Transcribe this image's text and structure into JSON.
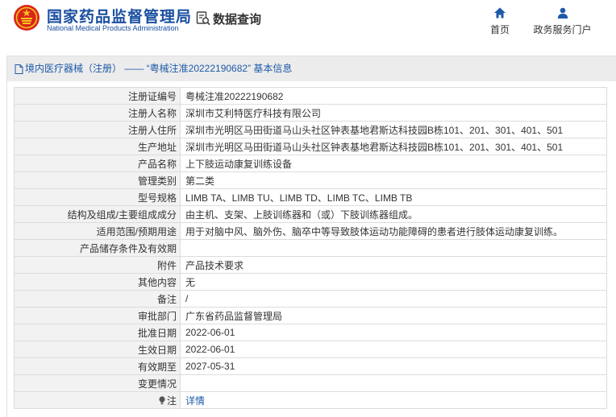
{
  "header": {
    "site_name_cn": "国家药品监督管理局",
    "site_name_en": "National Medical Products Administration",
    "data_query_label": "数据查询",
    "nav": [
      {
        "label": "首页",
        "icon": "home-icon"
      },
      {
        "label": "政务服务门户",
        "icon": "user-icon"
      }
    ]
  },
  "colors": {
    "brand": "#1a4fa0",
    "link": "#1d5aa8",
    "label_bg": "#f2f2f2",
    "title_bg": "#ececec"
  },
  "panel": {
    "title": "境内医疗器械（注册） —— “粤械注准20222190682” 基本信息"
  },
  "rows": [
    {
      "label": "注册证编号",
      "value": "粤械注准20222190682"
    },
    {
      "label": "注册人名称",
      "value": "深圳市艾利特医疗科技有限公司"
    },
    {
      "label": "注册人住所",
      "value": "深圳市光明区马田街道马山头社区钟表基地君斯达科技园B栋101、201、301、401、501"
    },
    {
      "label": "生产地址",
      "value": "深圳市光明区马田街道马山头社区钟表基地君斯达科技园B栋101、201、301、401、501"
    },
    {
      "label": "产品名称",
      "value": "上下肢运动康复训练设备"
    },
    {
      "label": "管理类别",
      "value": "第二类"
    },
    {
      "label": "型号规格",
      "value": "LIMB TA、LIMB TU、LIMB TD、LIMB TC、LIMB TB"
    },
    {
      "label": "结构及组成/主要组成成分",
      "value": "由主机、支架、上肢训练器和（或）下肢训练器组成。"
    },
    {
      "label": "适用范围/预期用途",
      "value": "用于对脑中风、脑外伤、脑卒中等导致肢体运动功能障碍的患者进行肢体运动康复训练。"
    },
    {
      "label": "产品储存条件及有效期",
      "value": ""
    },
    {
      "label": "附件",
      "value": "产品技术要求"
    },
    {
      "label": "其他内容",
      "value": "无"
    },
    {
      "label": "备注",
      "value": "/"
    },
    {
      "label": "审批部门",
      "value": "广东省药品监督管理局"
    },
    {
      "label": "批准日期",
      "value": "2022-06-01"
    },
    {
      "label": "生效日期",
      "value": "2022-06-01"
    },
    {
      "label": "有效期至",
      "value": "2027-05-31"
    },
    {
      "label": "变更情况",
      "value": ""
    }
  ],
  "note_row": {
    "label": "注",
    "icon": "lightbulb-icon",
    "link_text": "详情"
  }
}
